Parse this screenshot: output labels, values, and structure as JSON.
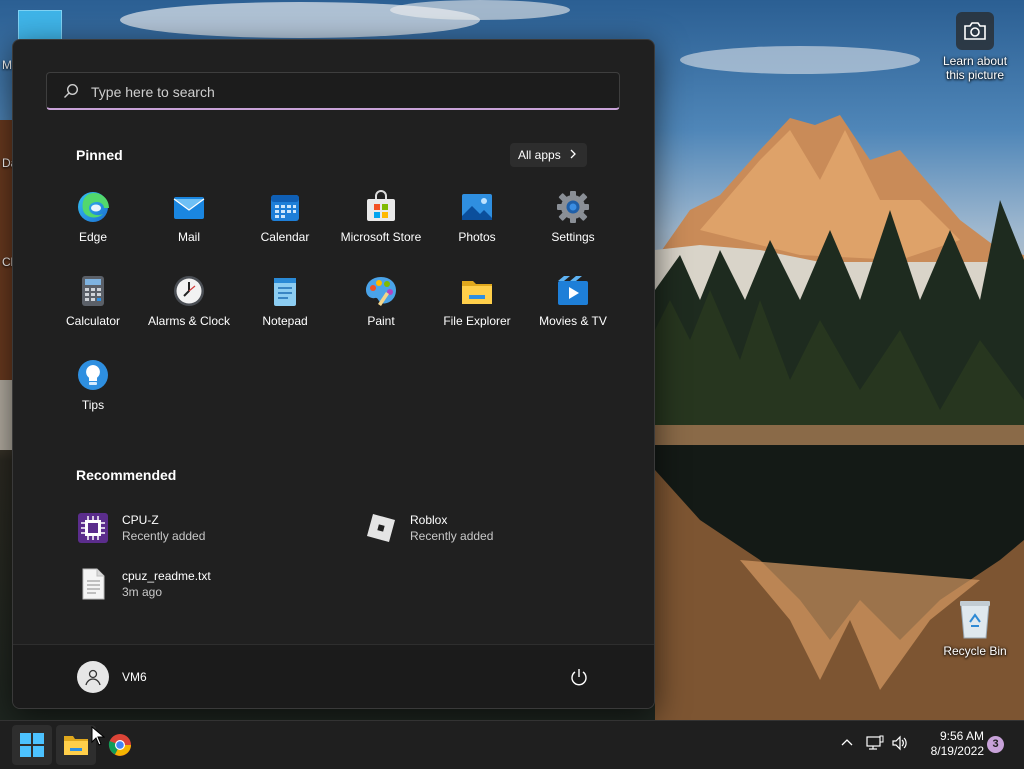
{
  "desktop": {
    "camera_label": "Learn about this picture",
    "recycle_bin_label": "Recycle Bin",
    "partial_left_labels": [
      "M",
      "Da",
      "Cl"
    ]
  },
  "start_menu": {
    "search": {
      "placeholder": "Type here to search"
    },
    "pinned": {
      "title": "Pinned",
      "all_apps_label": "All apps",
      "apps": [
        {
          "label": "Edge",
          "icon": "edge-icon"
        },
        {
          "label": "Mail",
          "icon": "mail-icon"
        },
        {
          "label": "Calendar",
          "icon": "calendar-icon"
        },
        {
          "label": "Microsoft Store",
          "icon": "store-icon"
        },
        {
          "label": "Photos",
          "icon": "photos-icon"
        },
        {
          "label": "Settings",
          "icon": "settings-icon"
        },
        {
          "label": "Calculator",
          "icon": "calculator-icon"
        },
        {
          "label": "Alarms & Clock",
          "icon": "clock-icon"
        },
        {
          "label": "Notepad",
          "icon": "notepad-icon"
        },
        {
          "label": "Paint",
          "icon": "paint-icon"
        },
        {
          "label": "File Explorer",
          "icon": "folder-icon"
        },
        {
          "label": "Movies & TV",
          "icon": "movies-icon"
        },
        {
          "label": "Tips",
          "icon": "tips-icon"
        }
      ]
    },
    "recommended": {
      "title": "Recommended",
      "items": [
        {
          "name": "CPU-Z",
          "detail": "Recently added",
          "icon": "cpuz-icon"
        },
        {
          "name": "Roblox",
          "detail": "Recently added",
          "icon": "roblox-icon"
        },
        {
          "name": "cpuz_readme.txt",
          "detail": "3m ago",
          "icon": "text-file-icon"
        }
      ]
    },
    "user": {
      "name": "VM6"
    }
  },
  "taskbar": {
    "time": "9:56 AM",
    "date": "8/19/2022",
    "notification_count": "3"
  },
  "colors": {
    "menu_bg": "#202020",
    "accent": "#c9a3d8",
    "taskbar_bg": "#1f1f1f"
  }
}
